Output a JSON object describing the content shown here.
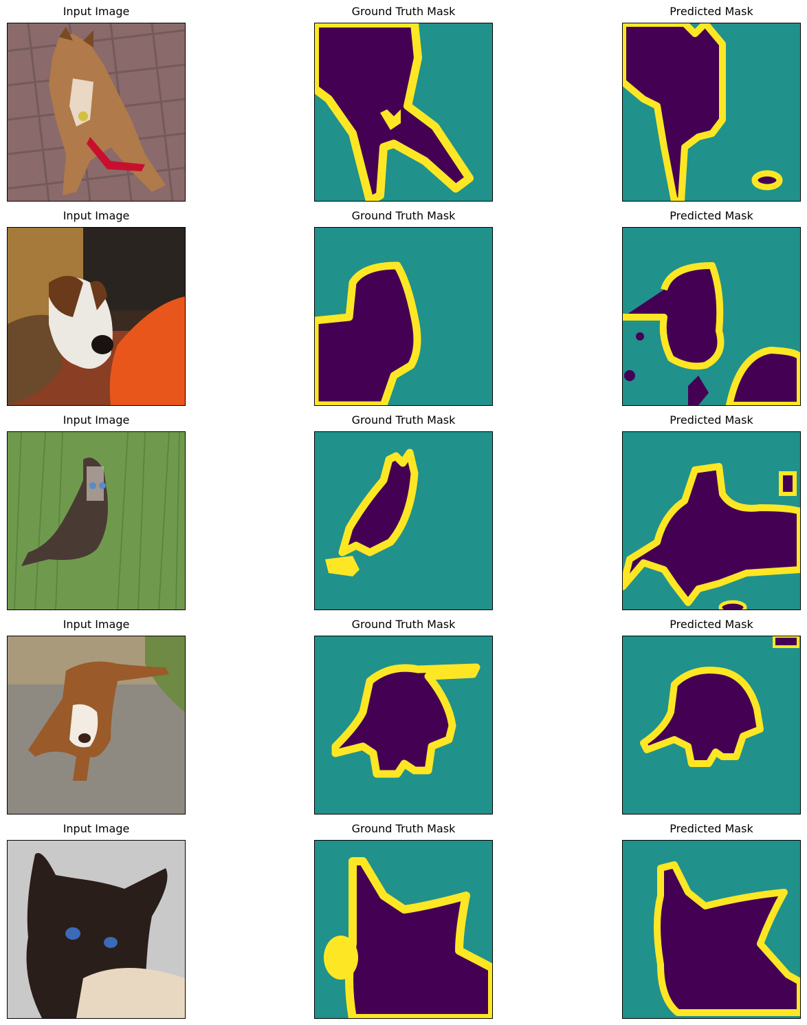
{
  "figure": {
    "rows": [
      {
        "input_title": "Input Image",
        "gt_title": "Ground Truth Mask",
        "pred_title": "Predicted Mask",
        "input_subject": "shiba inu dog on brick pavement with red toy",
        "scene_colors": {
          "bg": "#8a6a6a",
          "subject": "#b07a4a"
        }
      },
      {
        "input_title": "Input Image",
        "gt_title": "Ground Truth Mask",
        "pred_title": "Predicted Mask",
        "input_subject": "brown and white boxer dog in a room with orange cushion",
        "scene_colors": {
          "bg": "#5a3a28",
          "subject": "#ece8e2"
        }
      },
      {
        "input_title": "Input Image",
        "gt_title": "Ground Truth Mask",
        "pred_title": "Predicted Mask",
        "input_subject": "siamese cat sitting in green grass",
        "scene_colors": {
          "bg": "#6f9a4e",
          "subject": "#4a3a34"
        }
      },
      {
        "input_title": "Input Image",
        "gt_title": "Ground Truth Mask",
        "pred_title": "Predicted Mask",
        "input_subject": "basset hound on gravel path",
        "scene_colors": {
          "bg": "#8e8a82",
          "subject": "#9a5a2a"
        }
      },
      {
        "input_title": "Input Image",
        "gt_title": "Ground Truth Mask",
        "pred_title": "Predicted Mask",
        "input_subject": "siamese cat close-up with blue eyes",
        "scene_colors": {
          "bg": "#c9c9c9",
          "subject": "#2a1e1a"
        }
      }
    ],
    "mask_colors": {
      "background": "#21918c",
      "foreground": "#440154",
      "boundary": "#fde725"
    }
  }
}
